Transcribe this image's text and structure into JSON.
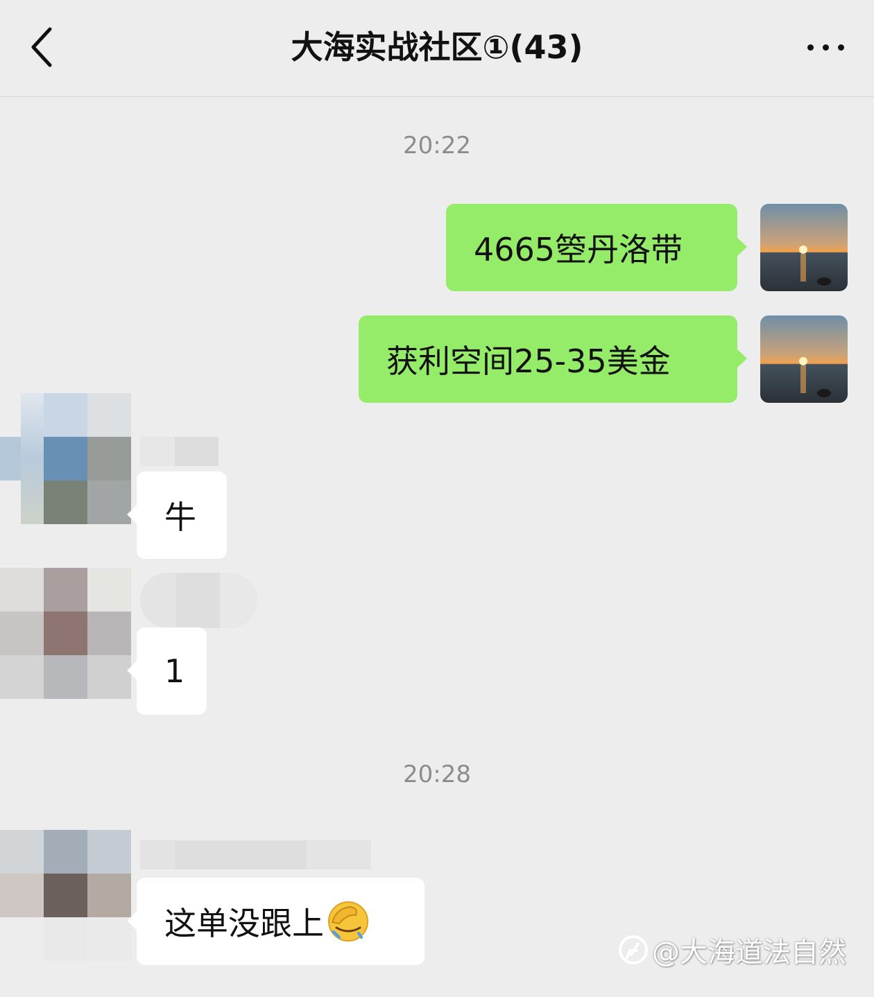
{
  "header": {
    "title": "大海实战社区①(43)"
  },
  "messages": {
    "time_1": "20:22",
    "time_2": "20:28",
    "out_1": "4665箜丹洛带",
    "out_2": "获利空间25-35美金",
    "in_1": "牛",
    "in_2": "1",
    "in_3": "这单没跟上"
  },
  "watermark": "@大海道法自然",
  "icons": [
    "back-arrow-icon",
    "more-dots-icon",
    "sunset-avatar",
    "facepalm-emoji-icon",
    "watermark-logo-icon"
  ],
  "colors": {
    "background": "#ededed",
    "outgoing_bubble": "#95ec69",
    "incoming_bubble": "#ffffff",
    "timestamp": "#8c8c8c"
  }
}
